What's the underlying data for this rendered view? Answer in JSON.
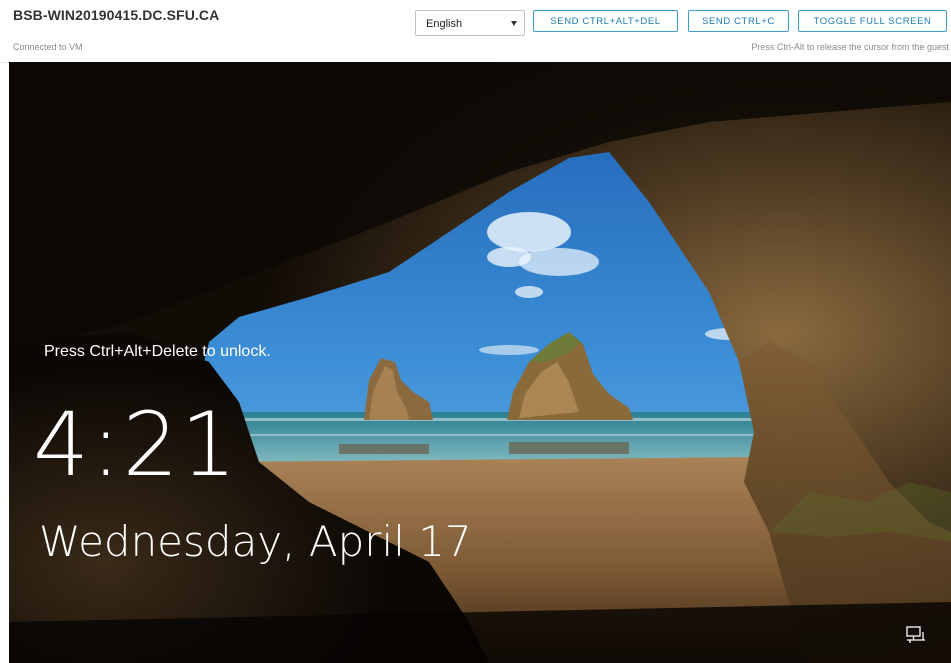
{
  "console": {
    "vm_name": "BSB-WIN20190415.DC.SFU.CA",
    "status": "Connected to VM",
    "hint": "Press Ctrl-Alt to release the cursor from the guest",
    "language": {
      "selected": "English"
    },
    "buttons": {
      "ctrl_alt_del": "SEND CTRL+ALT+DEL",
      "ctrl_c": "SEND CTRL+C",
      "fullscreen": "TOGGLE FULL SCREEN"
    },
    "accent_color": "#1b7db3"
  },
  "lockscreen": {
    "unlock_hint": "Press Ctrl+Alt+Delete to unlock.",
    "time": "4:21",
    "date": "Wednesday, April 17",
    "icons": [
      "network-icon"
    ]
  }
}
